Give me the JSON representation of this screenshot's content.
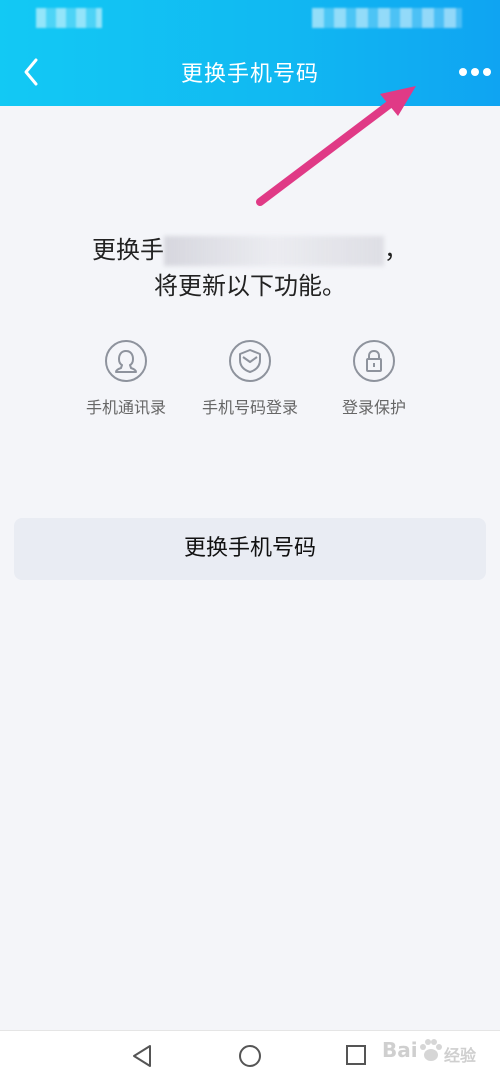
{
  "header": {
    "title": "更换手机号码",
    "back_icon": "chevron-left-icon",
    "more_icon": "more-horizontal-icon"
  },
  "info": {
    "line1_prefix": "更换手",
    "line1_suffix": "，",
    "line2": "将更新以下功能。"
  },
  "features": [
    {
      "label": "手机通讯录",
      "icon": "contacts-icon"
    },
    {
      "label": "手机号码登录",
      "icon": "shield-icon"
    },
    {
      "label": "登录保护",
      "icon": "lock-icon"
    }
  ],
  "button": {
    "label": "更换手机号码"
  },
  "colors": {
    "header_start": "#12c9f4",
    "header_end": "#0fa4f2",
    "background": "#f4f5f9",
    "button_bg": "#e9ecf3",
    "annotation_arrow": "#e03a86"
  },
  "watermark": {
    "prefix": "Bai",
    "suffix": "经验"
  }
}
